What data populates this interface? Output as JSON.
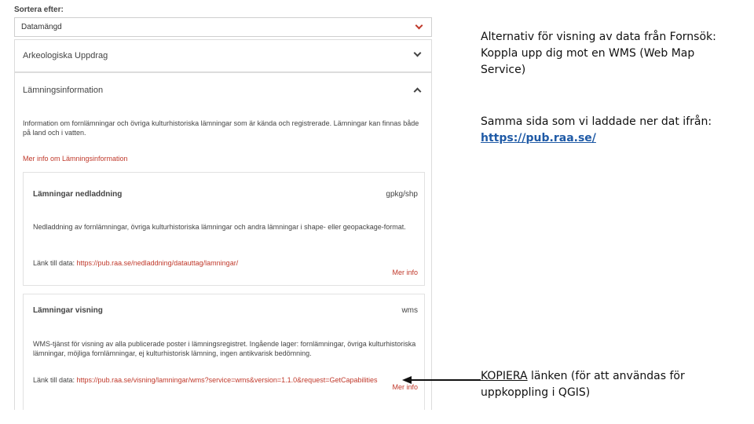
{
  "panel": {
    "sort_label": "Sortera efter:",
    "sort_value": "Datamängd",
    "accordion_1": "Arkeologiska Uppdrag",
    "accordion_2": "Lämningsinformation",
    "intro_text": "Information om fornlämningar och övriga kulturhistoriska lämningar som är kända och registrerade. Lämningar kan finnas både på land och i vatten.",
    "more_link": "Mer info om Lämningsinformation",
    "cards": [
      {
        "title": "Lämningar nedladdning",
        "format": "gpkg/shp",
        "description": "Nedladdning av fornlämningar, övriga kulturhistoriska lämningar och andra lämningar i shape- eller geopackage-format.",
        "link_label": "Länk till data: ",
        "link_url": "https://pub.raa.se/nedladdning/datauttag/lamningar/",
        "more": "Mer info"
      },
      {
        "title": "Lämningar visning",
        "format": "wms",
        "description": "WMS-tjänst för visning av alla publicerade poster i lämningsregistret. Ingående lager: fornlämningar, övriga kulturhistoriska lämningar, möjliga fornlämningar, ej kulturhistorisk lämning, ingen antikvarisk bedömning.",
        "link_label": "Länk till data: ",
        "link_url": "https://pub.raa.se/visning/lamningar/wms?service=wms&version=1.1.0&request=GetCapabilities",
        "more": "Mer info"
      }
    ]
  },
  "notes": {
    "note_1": "Alternativ för visning av data från Fornsök: Koppla upp dig mot en WMS (Web Map Service)",
    "note_2_text": "Samma sida som vi laddade ner dat ifrån: ",
    "note_2_link": "https://pub.raa.se/",
    "note_3_underlined": "KOPIERA",
    "note_3_rest": " länken (för att användas för uppkoppling i QGIS)"
  },
  "colors": {
    "accent": "#c0392b",
    "link_blue": "#1f5aa6"
  }
}
